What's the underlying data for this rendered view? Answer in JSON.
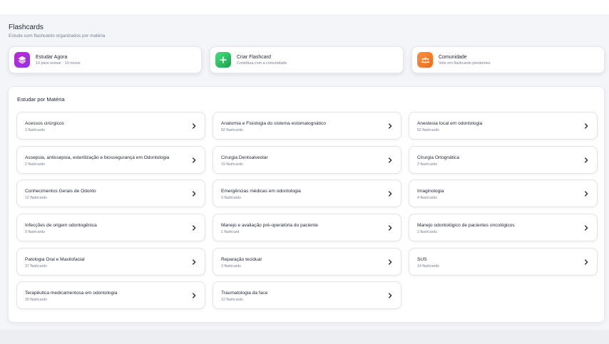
{
  "header": {
    "title": "Flashcards",
    "subtitle": "Estude com flashcards organizados por matéria"
  },
  "actions": [
    {
      "title": "Estudar Agora",
      "subtitle": "10 para revisar · 10 novos",
      "icon": "layers-icon",
      "color_from": "#c026d3",
      "color_to": "#9333ea"
    },
    {
      "title": "Criar Flashcard",
      "subtitle": "Contribua com a comunidade",
      "icon": "plus-icon",
      "color_from": "#4ade80",
      "color_to": "#16a34a"
    },
    {
      "title": "Comunidade",
      "subtitle": "Vote em flashcards pendentes",
      "icon": "users-icon",
      "color_from": "#fb923c",
      "color_to": "#ef6a1f"
    }
  ],
  "section": {
    "title": "Estudar por Matéria"
  },
  "subjects": [
    {
      "name": "Acessos cirúrgicos",
      "count": "3 flashcards"
    },
    {
      "name": "Anatomia e Fisiologia do sistema estomatognático",
      "count": "82 flashcards"
    },
    {
      "name": "Anestesia local em odontologia",
      "count": "52 flashcards"
    },
    {
      "name": "Assepsia, antissepsia, esterilização e biossegurança em Odontologia",
      "count": "2 flashcards"
    },
    {
      "name": "Cirurgia Dentoalveolar",
      "count": "19 flashcards"
    },
    {
      "name": "Cirurgia Ortognática",
      "count": "2 flashcards"
    },
    {
      "name": "Conhecimentos Gerais de Odonto",
      "count": "12 flashcards"
    },
    {
      "name": "Emergências médicas em odontologia",
      "count": "9 flashcards"
    },
    {
      "name": "Imaginologia",
      "count": "4 flashcards"
    },
    {
      "name": "Infecções de origem odontogênica",
      "count": "9 flashcards"
    },
    {
      "name": "Manejo e avaliação pré-operatória do paciente",
      "count": "1 flashcard"
    },
    {
      "name": "Manejo odontológico de pacientes oncológicos",
      "count": "2 flashcards"
    },
    {
      "name": "Patologia Oral e Maxilofacial",
      "count": "37 flashcards"
    },
    {
      "name": "Reparação tecidual",
      "count": "3 flashcards"
    },
    {
      "name": "SUS",
      "count": "14 flashcards"
    },
    {
      "name": "Terapêutica medicamentosa em odontologia",
      "count": "30 flashcards"
    },
    {
      "name": "Traumatologia da face",
      "count": "12 flashcards"
    }
  ]
}
